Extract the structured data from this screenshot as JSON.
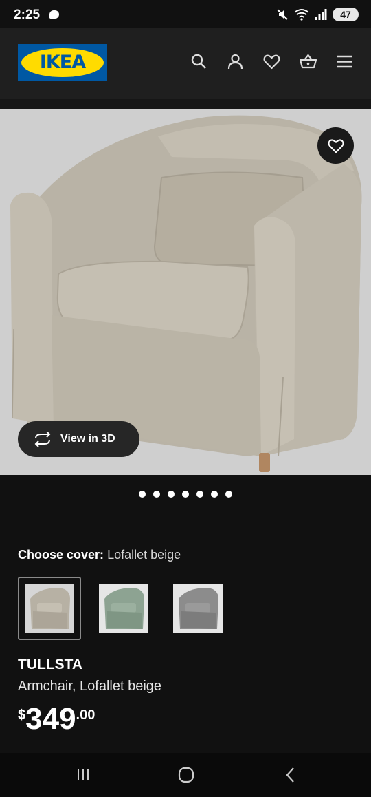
{
  "status_bar": {
    "time": "2:25",
    "battery": "47"
  },
  "header": {
    "logo_text": "IKEA",
    "icons": [
      "search-icon",
      "profile-icon",
      "heart-icon",
      "cart-icon",
      "menu-icon"
    ]
  },
  "hero": {
    "view_3d_label": "View in 3D",
    "image_count": 7
  },
  "cover": {
    "label": "Choose cover:",
    "value": "Lofallet beige",
    "swatches": [
      {
        "name": "Lofallet beige",
        "color": "#b7b1a4",
        "selected": true
      },
      {
        "name": "green",
        "color": "#8da392",
        "selected": false
      },
      {
        "name": "grey",
        "color": "#8c8c8c",
        "selected": false
      }
    ]
  },
  "product": {
    "name": "TULLSTA",
    "description": "Armchair, Lofallet beige",
    "price_currency": "$",
    "price_int": "349",
    "price_dec": ".00"
  },
  "colors": {
    "background": "#111111",
    "header": "#1f1f1f",
    "ikea_blue": "#0058a3",
    "ikea_yellow": "#ffdb00",
    "hero_bg": "#cfcfcf",
    "chair_fabric": "#b3ad9f"
  }
}
